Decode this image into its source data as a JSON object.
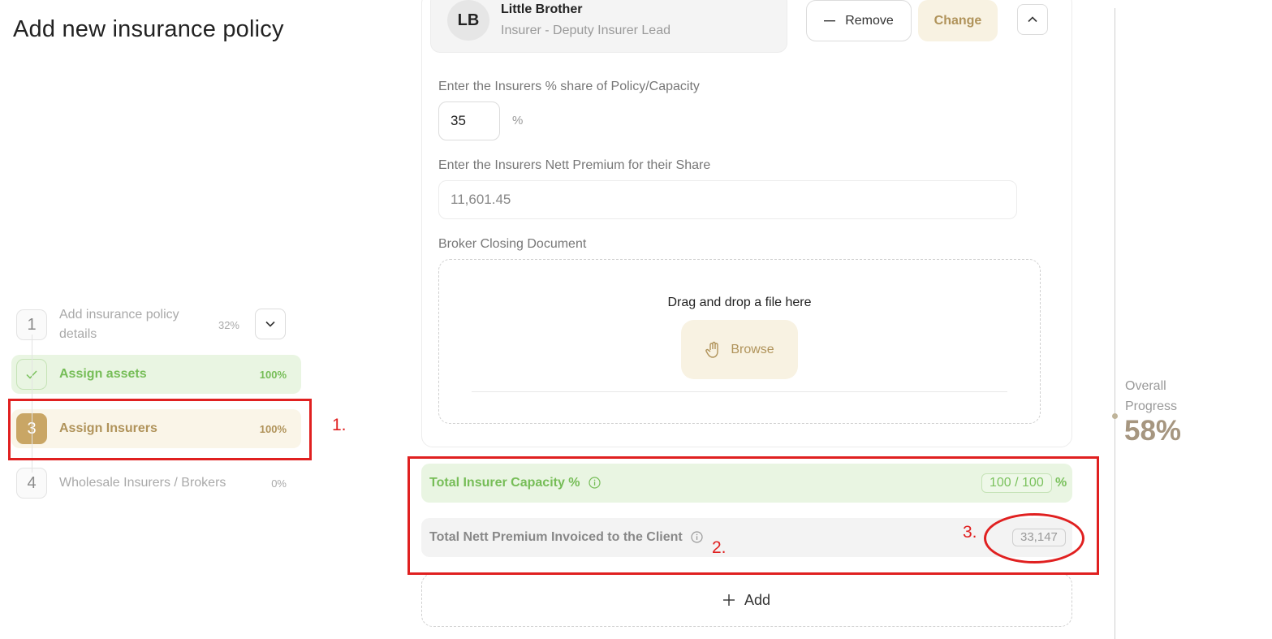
{
  "page": {
    "title": "Add new insurance policy"
  },
  "stepper": {
    "steps": [
      {
        "num": "1",
        "label": "Add insurance policy details",
        "pct": "32%"
      },
      {
        "num": "✓",
        "label": "Assign assets",
        "pct": "100%"
      },
      {
        "num": "3",
        "label": "Assign Insurers",
        "pct": "100%"
      },
      {
        "num": "4",
        "label": "Wholesale Insurers / Brokers",
        "pct": "0%"
      }
    ]
  },
  "insurer": {
    "initials": "LB",
    "name": "Little Brother",
    "role": "Insurer - Deputy Insurer Lead",
    "remove_label": "Remove",
    "change_label": "Change"
  },
  "form": {
    "share_label": "Enter the Insurers % share of Policy/Capacity",
    "share_value": "35",
    "share_unit": "%",
    "premium_label": "Enter the Insurers Nett Premium for their Share",
    "premium_value": "11,601.45",
    "doc_label": "Broker Closing Document",
    "drop_text": "Drag and drop a file here",
    "browse_label": "Browse"
  },
  "totals": {
    "capacity_label": "Total Insurer Capacity %",
    "capacity_value": "100 / 100",
    "capacity_unit": "%",
    "premium_label": "Total Nett Premium Invoiced to the Client",
    "premium_value": "33,147"
  },
  "add_label": "Add",
  "progress": {
    "label": "Overall Progress",
    "value": "58%"
  },
  "annotations": {
    "a1": "1.",
    "a2": "2.",
    "a3": "3."
  },
  "colors": {
    "accent_gold": "#c9a665",
    "success_green": "#76bd57",
    "annotation_red": "#e02020"
  }
}
